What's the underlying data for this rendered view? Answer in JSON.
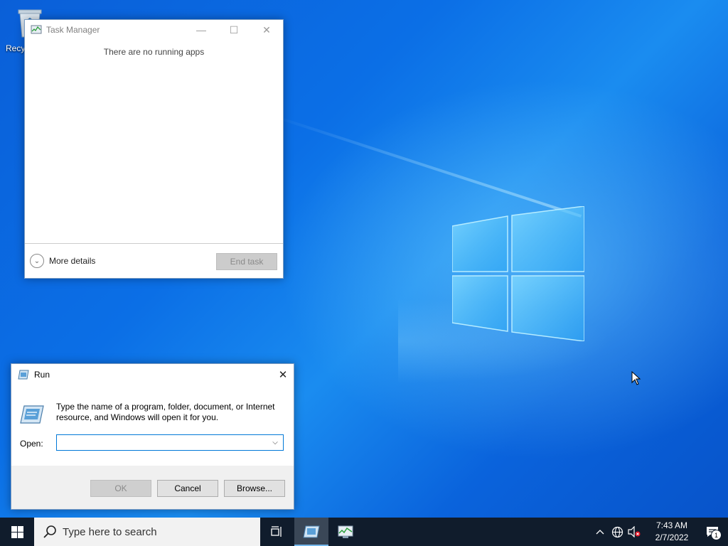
{
  "desktop": {
    "recycle_bin_label": "Recy"
  },
  "task_manager": {
    "title": "Task Manager",
    "message": "There are no running apps",
    "more_details": "More details",
    "end_task": "End task",
    "controls": {
      "minimize": "—",
      "maximize": "☐",
      "close": "✕"
    }
  },
  "run_dialog": {
    "title": "Run",
    "description": "Type the name of a program, folder, document, or Internet resource, and Windows will open it for you.",
    "open_label": "Open:",
    "open_value": "",
    "buttons": {
      "ok": "OK",
      "cancel": "Cancel",
      "browse": "Browse..."
    },
    "close": "✕"
  },
  "taskbar": {
    "search_placeholder": "Type here to search",
    "clock_time": "7:43 AM",
    "clock_date": "2/7/2022",
    "notification_count": "1",
    "tray_chevron": "^"
  },
  "colors": {
    "taskbar": "#101c2c",
    "accent": "#0078d7",
    "desktop": "#0b6fe6"
  }
}
